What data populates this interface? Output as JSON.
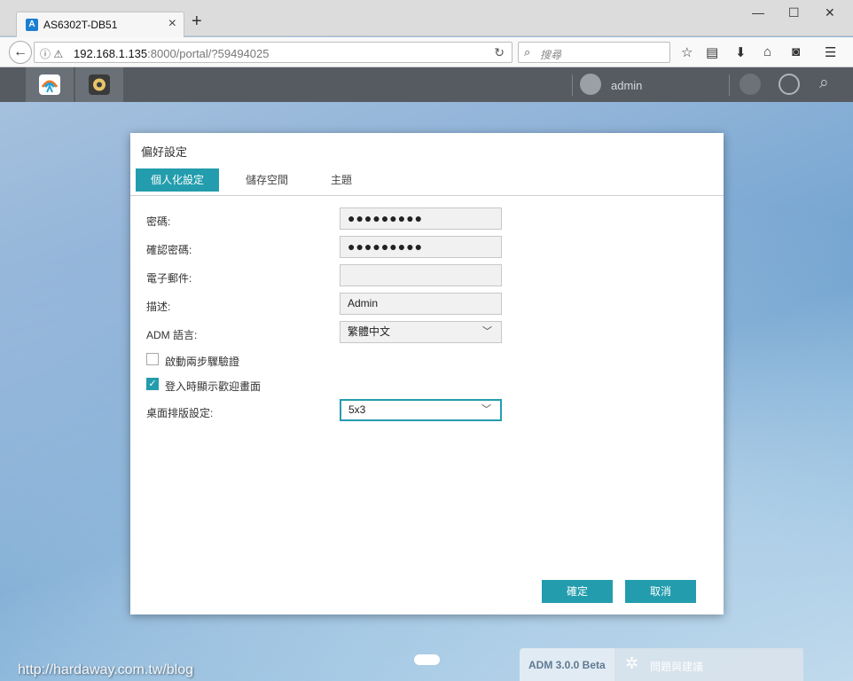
{
  "browser": {
    "tab_title": "AS6302T-DB51",
    "tab_logo": "A",
    "url_host": "192.168.1.135",
    "url_rest": ":8000/portal/?59494025",
    "search_placeholder": "搜尋"
  },
  "adm": {
    "username": "admin"
  },
  "dialog": {
    "title": "偏好設定",
    "tabs": [
      "個人化設定",
      "儲存空間",
      "主題"
    ],
    "fields": {
      "password_label": "密碼:",
      "password_value": "●●●●●●●●●",
      "confirm_label": "確認密碼:",
      "confirm_value": "●●●●●●●●●",
      "email_label": "電子郵件:",
      "email_value": "",
      "description_label": "描述:",
      "description_value": "Admin",
      "language_label": "ADM 語言:",
      "language_value": "繁體中文",
      "two_step_label": "啟動兩步驟驗證",
      "two_step_checked": false,
      "welcome_label": "登入時顯示歡迎畫面",
      "welcome_checked": true,
      "layout_label": "桌面排版設定:",
      "layout_value": "5x3"
    },
    "ok_label": "確定",
    "cancel_label": "取消"
  },
  "bottom": {
    "version": "ADM 3.0.0 Beta",
    "feedback": "問題與建議"
  },
  "watermark": "http://hardaway.com.tw/blog"
}
